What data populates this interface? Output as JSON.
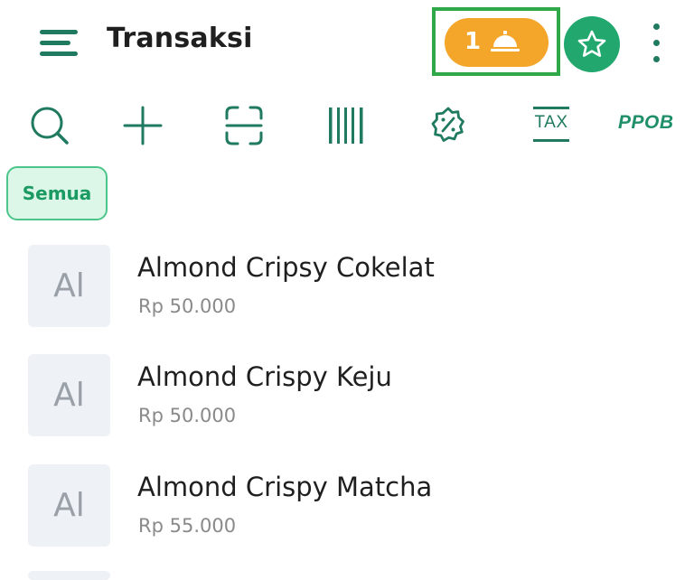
{
  "header": {
    "title": "Transaksi",
    "order_count": "1",
    "highlight_color": "#2fa84a",
    "accent_color": "#22a86f",
    "order_button_color": "#f4a62a"
  },
  "toolbar": {
    "icons": [
      "search-icon",
      "add-icon",
      "scan-icon",
      "barcode-icon",
      "discount-icon"
    ],
    "tax_label": "TAX",
    "ppob_label": "PPOB"
  },
  "filter": {
    "active_label": "Semua"
  },
  "products": [
    {
      "initials": "Al",
      "name": "Almond Cripsy Cokelat",
      "price": "Rp 50.000"
    },
    {
      "initials": "Al",
      "name": "Almond Crispy Keju",
      "price": "Rp 50.000"
    },
    {
      "initials": "Al",
      "name": "Almond Crispy Matcha",
      "price": "Rp 55.000"
    }
  ]
}
